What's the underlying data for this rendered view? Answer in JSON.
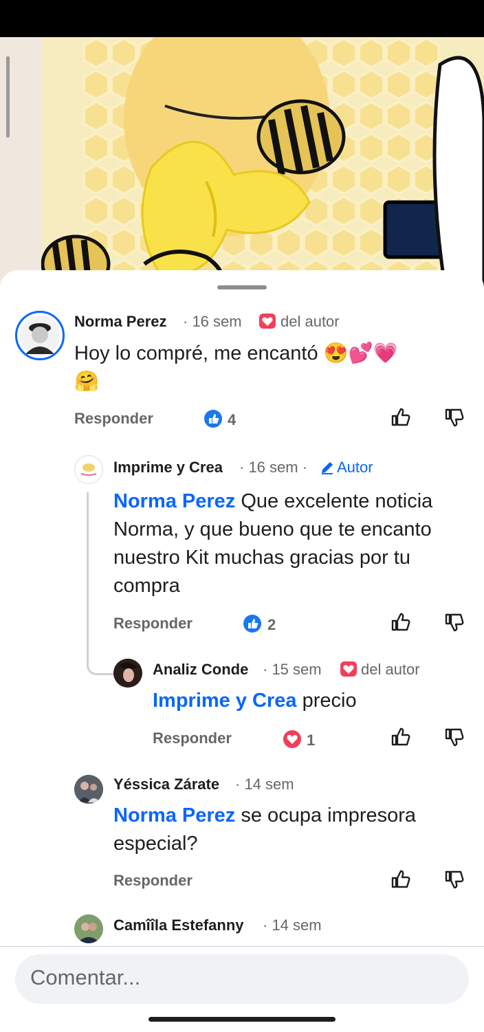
{
  "composer": {
    "placeholder": "Comentar..."
  },
  "comments": [
    {
      "author": "Norma Perez",
      "time": "· 16 sem",
      "badge": "del autor",
      "text": "Hoy lo compré, me encantó 😍💕💗",
      "text2": "🤗",
      "reply_label": "Responder",
      "reaction": {
        "type": "like",
        "count": "4"
      }
    },
    {
      "author": "Imprime y Crea",
      "time": "· 16 sem ·",
      "badge": "Autor",
      "mention": "Norma Perez",
      "text": "Que excelente noticia Norma, y que bueno que te encanto nuestro Kit muchas gracias por tu compra",
      "reply_label": "Responder",
      "reaction": {
        "type": "like",
        "count": "2"
      }
    },
    {
      "author": "Analiz Conde",
      "time": "· 15 sem",
      "badge": "del autor",
      "mention": "Imprime y Crea",
      "text": "precio",
      "reply_label": "Responder",
      "reaction": {
        "type": "love",
        "count": "1"
      }
    },
    {
      "author": "Yéssica Zárate",
      "time": "· 14 sem",
      "mention": "Norma Perez",
      "text": "se ocupa impresora especial?",
      "reply_label": "Responder"
    },
    {
      "author": "Camîîla Estefanny",
      "time": "· 14 sem"
    }
  ],
  "colors": {
    "accent": "#0866ff",
    "love": "#f33e58",
    "secondary_text": "#65676b"
  }
}
